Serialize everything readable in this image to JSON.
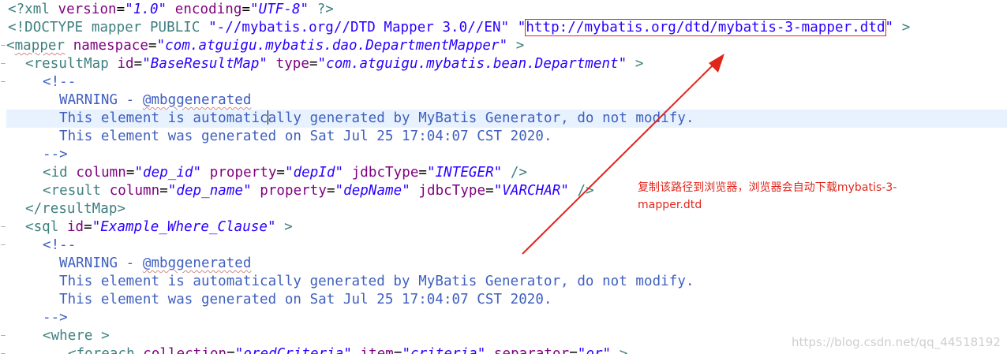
{
  "code": {
    "xml_decl": {
      "open": "<?xml ",
      "a1": "version",
      "v1": "\"1.0\"",
      "a2": "encoding",
      "v2": "\"UTF-8\"",
      "close": " ?>"
    },
    "doctype": {
      "open": "<!DOCTYPE mapper PUBLIC ",
      "pubid": "\"-//mybatis.org//DTD Mapper 3.0//EN\"",
      "sysid_q": "\"",
      "sysid": "http://mybatis.org/dtd/mybatis-3-mapper.dtd",
      "sysid_q2": "\"",
      "close": " >"
    },
    "mapper": {
      "open": "<",
      "name": "mapper",
      "attr": "namespace",
      "val": "\"com.atguigu.mybatis.dao.DepartmentMapper\"",
      "close": " >"
    },
    "resultmap": {
      "open": "<resultMap ",
      "a1": "id",
      "v1": "\"BaseResultMap\"",
      "a2": "type",
      "v2": "\"com.atguigu.mybatis.bean.Department\"",
      "close": " >"
    },
    "comment1": {
      "open": "<!--",
      "warning_prefix": "WARNING - ",
      "warning_tag": "@mbggenerated",
      "line2_a": "This element is automatic",
      "line2_b": "ally generated by MyBatis Generator, do not modify.",
      "line3": "This element was generated on Sat Jul 25 17:04:07 CST 2020.",
      "close": "-->"
    },
    "id_el": {
      "open": "<id ",
      "a1": "column",
      "v1": "\"dep_id\"",
      "a2": "property",
      "v2": "\"depId\"",
      "a3": "jdbcType",
      "v3": "\"INTEGER\"",
      "close": " />"
    },
    "result_el": {
      "open": "<result ",
      "a1": "column",
      "v1": "\"dep_name\"",
      "a2": "property",
      "v2": "\"depName\"",
      "a3": "jdbcType",
      "v3": "\"VARCHAR\"",
      "close": " />"
    },
    "resultmap_end": "</resultMap>",
    "sql": {
      "open": "<sql ",
      "a1": "id",
      "v1": "\"Example_Where_Clause\"",
      "close": " >"
    },
    "comment2": {
      "open": "<!--",
      "warning_prefix": "WARNING - ",
      "warning_tag": "@mbggenerated",
      "line2": "This element is automatically generated by MyBatis Generator, do not modify.",
      "line3": "This element was generated on Sat Jul 25 17:04:07 CST 2020.",
      "close": "-->"
    },
    "where": "<where >",
    "foreach": {
      "open": "<foreach ",
      "a1": "collection",
      "v1": "\"oredCriteria\"",
      "a2": "item",
      "v2": "\"criteria\"",
      "a3": "separator",
      "v3": "\"or\"",
      "close": " >"
    }
  },
  "annotation": {
    "text_line1": "复制该路径到浏览器，浏览器会自动下载mybatis-3-",
    "text_line2": "mapper.dtd",
    "color": "#e0261b"
  },
  "watermark": "https://blog.csdn.net/qq_44518192",
  "colors": {
    "tag": "#3f7f7f",
    "attr": "#7f007f",
    "value": "#2a00ff",
    "comment": "#3f5fbf",
    "current_line": "#e8f2fe"
  }
}
